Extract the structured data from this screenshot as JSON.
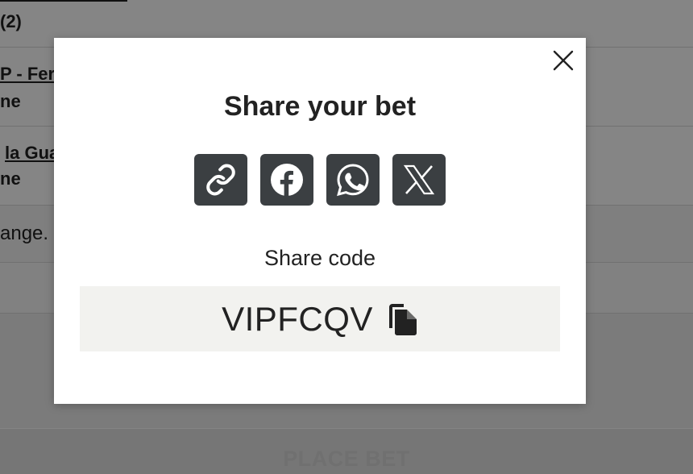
{
  "background": {
    "rows": [
      {
        "text": "(2)"
      },
      {
        "title": "P - Ferr",
        "subtitle": "ne"
      },
      {
        "title": "la Gua",
        "subtitle": "ne"
      },
      {
        "text": "ange."
      }
    ],
    "place_bet_label": "PLACE BET"
  },
  "modal": {
    "title": "Share your bet",
    "share_buttons": [
      {
        "icon": "link-icon"
      },
      {
        "icon": "facebook-icon"
      },
      {
        "icon": "whatsapp-icon"
      },
      {
        "icon": "x-icon"
      }
    ],
    "share_code_label": "Share code",
    "share_code": "VIPFCQV",
    "close_icon": "close-icon",
    "copy_icon": "copy-icon"
  },
  "colors": {
    "button_bg": "#3b3f42",
    "code_box_bg": "#f2f2ef",
    "overlay": "rgba(0,0,0,0.48)"
  }
}
